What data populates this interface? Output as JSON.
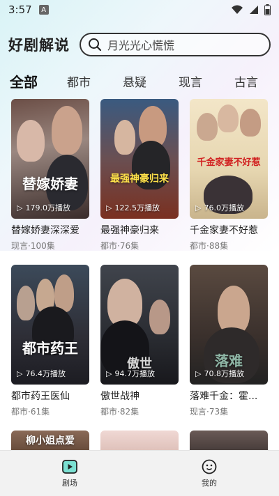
{
  "status_bar": {
    "time": "3:57",
    "notif": "A"
  },
  "header": {
    "title": "好剧解说",
    "search_placeholder": "月光光心慌慌"
  },
  "tabs": [
    {
      "label": "全部",
      "active": true
    },
    {
      "label": "都市",
      "active": false
    },
    {
      "label": "悬疑",
      "active": false
    },
    {
      "label": "现言",
      "active": false
    },
    {
      "label": "古言",
      "active": false
    }
  ],
  "cards": [
    {
      "title": "替嫁娇妻深深爱",
      "meta": "现言·100集",
      "plays": "179.0万播放",
      "art": "替嫁娇妻"
    },
    {
      "title": "最强神豪归来",
      "meta": "都市·76集",
      "plays": "122.5万播放",
      "art": "最强神豪归来"
    },
    {
      "title": "千金家妻不好惹",
      "meta": "都市·88集",
      "plays": "76.0万播放",
      "art": "千金家妻不好惹"
    },
    {
      "title": "都市药王医仙",
      "meta": "都市·61集",
      "plays": "76.4万播放",
      "art": "都市药王"
    },
    {
      "title": "傲世战神",
      "meta": "都市·82集",
      "plays": "94.7万播放",
      "art": "傲世"
    },
    {
      "title": "落难千金：霍...",
      "meta": "现言·73集",
      "plays": "70.8万播放",
      "art": "落难"
    }
  ],
  "partial_cards": [
    {
      "art": "柳小姐点爱"
    }
  ],
  "bottom_nav": [
    {
      "label": "剧场",
      "icon": "play-square-icon",
      "active": true
    },
    {
      "label": "我的",
      "icon": "smile-face-icon",
      "active": false
    }
  ]
}
